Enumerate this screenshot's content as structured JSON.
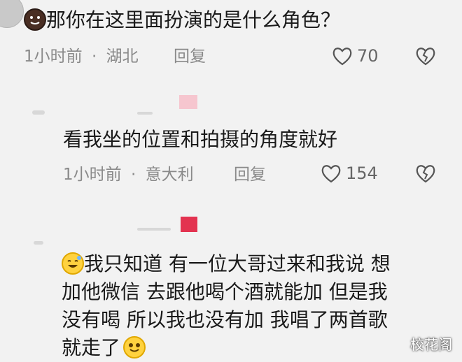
{
  "comment1": {
    "emoji": "pie-emoji",
    "text": "那你在这里面扮演的是什么角色？",
    "time": "1小时前",
    "location": "湖北",
    "separator": "·",
    "reply": "回复",
    "likes": "70"
  },
  "comment2": {
    "text": "看我坐的位置和拍摄的角度就好",
    "time": "1小时前",
    "location": "意大利",
    "separator": "·",
    "reply": "回复",
    "likes": "154"
  },
  "comment3": {
    "lines": [
      "我只知道 有一位大哥过来和我说 想",
      "加他微信 去跟他喝个酒就能加 但是我",
      "没有喝 所以我也没有加 我唱了两首歌",
      "就走了"
    ],
    "emoji_start": "sweat-smile-emoji",
    "emoji_end": "grin-emoji"
  },
  "watermark": "校花阁",
  "colors": {
    "background": "#f2f2f2",
    "meta_gray": "#8a8a8a",
    "red_marker": "#e33350",
    "pink_marker": "#f6c6cf"
  }
}
